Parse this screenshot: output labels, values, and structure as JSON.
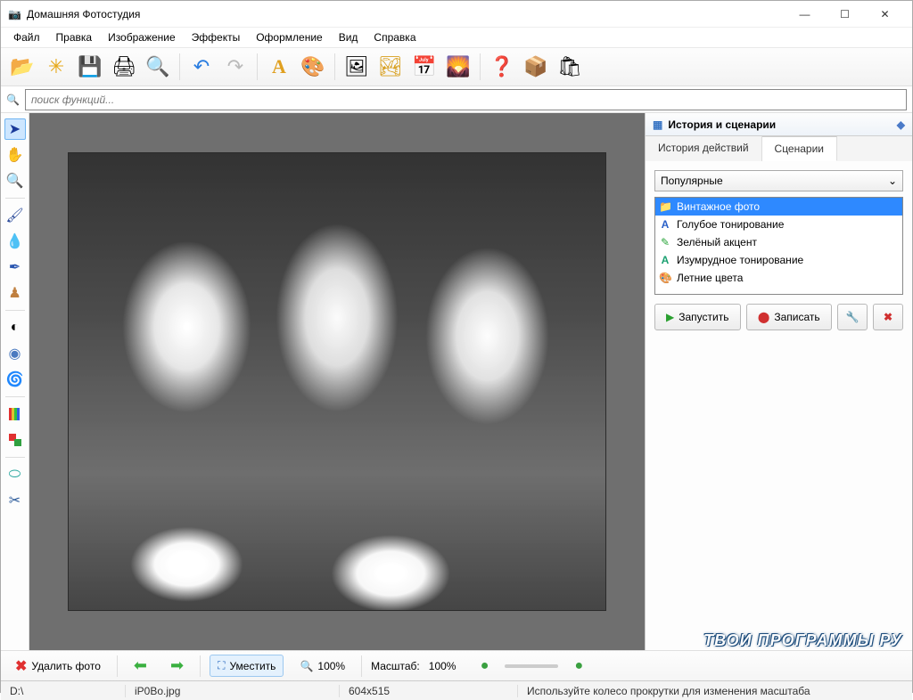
{
  "title": "Домашняя Фотостудия",
  "menu": [
    "Файл",
    "Правка",
    "Изображение",
    "Эффекты",
    "Оформление",
    "Вид",
    "Справка"
  ],
  "search": {
    "placeholder": "поиск функций..."
  },
  "panel": {
    "title": "История и сценарии",
    "tabs": [
      "История действий",
      "Сценарии"
    ],
    "active_tab": 1,
    "dropdown": "Популярные",
    "scenarios": [
      {
        "icon": "📁",
        "label": "Винтажное фото",
        "color": "#fff"
      },
      {
        "icon": "A",
        "label": "Голубое тонирование",
        "color": "#2a60c8"
      },
      {
        "icon": "✎",
        "label": "Зелёный акцент",
        "color": "#2aa53a"
      },
      {
        "icon": "A",
        "label": "Изумрудное тонирование",
        "color": "#1aa070"
      },
      {
        "icon": "🎨",
        "label": "Летние цвета",
        "color": "#c77b1a"
      }
    ],
    "buttons": {
      "run": "Запустить",
      "record": "Записать"
    }
  },
  "bottom": {
    "delete": "Удалить фото",
    "fit": "Уместить",
    "hundred": "100%",
    "scale_label": "Масштаб:",
    "scale_value": "100%"
  },
  "status": {
    "drive": "D:\\",
    "file": "iP0Bo.jpg",
    "dims": "604x515",
    "hint": "Используйте колесо прокрутки для изменения масштаба"
  },
  "watermark": "ТВОИ ПРОГРАММЫ РУ"
}
